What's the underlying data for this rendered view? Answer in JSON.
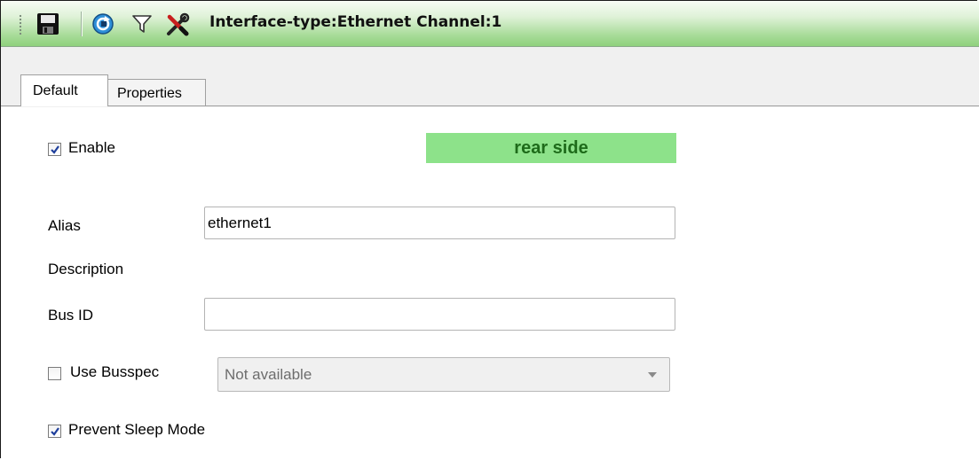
{
  "toolbar": {
    "title": "Interface-type:Ethernet Channel:1",
    "icons": [
      "save-icon",
      "refresh-icon",
      "filter-icon",
      "tools-icon"
    ]
  },
  "tabs": [
    {
      "label": "Default",
      "active": true
    },
    {
      "label": "Properties",
      "active": false
    }
  ],
  "form": {
    "enable": {
      "label": "Enable",
      "checked": true
    },
    "location_badge": "rear side",
    "alias": {
      "label": "Alias",
      "value": "ethernet1"
    },
    "description": {
      "label": "Description"
    },
    "bus_id": {
      "label": "Bus ID",
      "value": ""
    },
    "use_busspec": {
      "label": "Use Busspec",
      "checked": false,
      "selected": "Not available"
    },
    "prevent_sleep": {
      "label": "Prevent Sleep Mode",
      "checked": true
    }
  },
  "colors": {
    "toolbar_gradient_end": "#8fd17c",
    "badge_bg": "#8de28a",
    "badge_text": "#1e6b1a",
    "checkmark": "#1f3f9c"
  }
}
